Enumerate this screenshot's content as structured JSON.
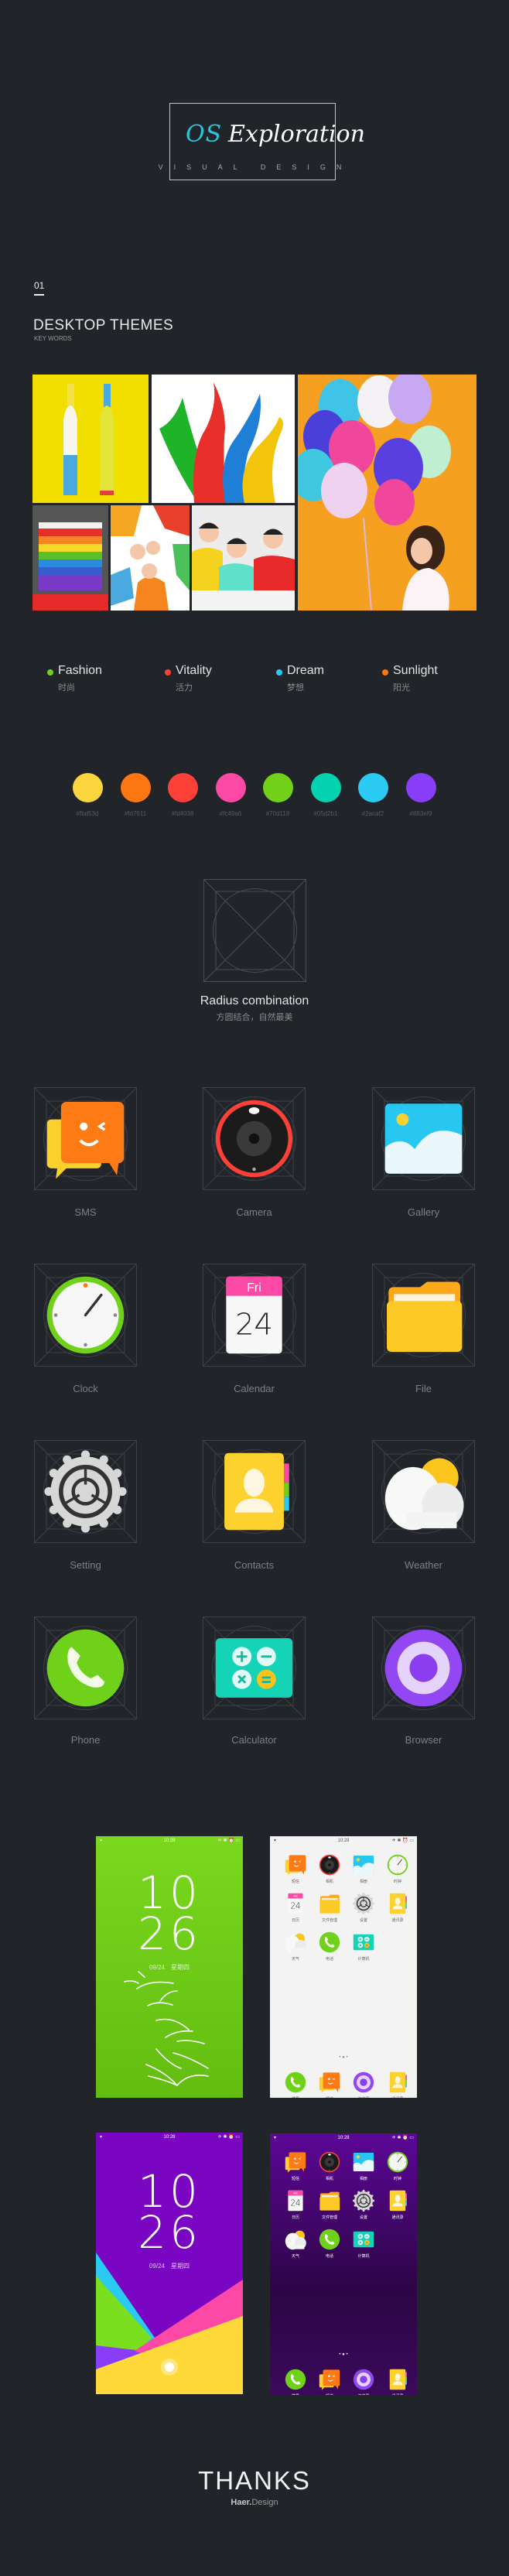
{
  "header": {
    "logo_os": "OS",
    "logo_rest": "Exploration",
    "tagline": "VISUAL DESIGN"
  },
  "section": {
    "number": "01",
    "title": "DESKTOP  THEMES",
    "subtitle": "KEY WORDS"
  },
  "keywords": [
    {
      "en": "Fashion",
      "cn": "时尚",
      "color": "#70d118"
    },
    {
      "en": "Vitality",
      "cn": "活力",
      "color": "#fd4038"
    },
    {
      "en": "Dream",
      "cn": "梦想",
      "color": "#2acaf2"
    },
    {
      "en": "Sunlight",
      "cn": "阳光",
      "color": "#fd7611"
    }
  ],
  "palette": [
    "#fbd53d",
    "#fd7611",
    "#fd4038",
    "#fc49a6",
    "#70d118",
    "#05d2b1",
    "#2acaf2",
    "#883ef9"
  ],
  "radius": {
    "title": "Radius combination",
    "subtitle": "方圆结合，自然最美"
  },
  "icons": [
    {
      "key": "sms",
      "label": "SMS"
    },
    {
      "key": "camera",
      "label": "Camera"
    },
    {
      "key": "gallery",
      "label": "Gallery"
    },
    {
      "key": "clock",
      "label": "Clock"
    },
    {
      "key": "calendar",
      "label": "Calendar"
    },
    {
      "key": "file",
      "label": "File"
    },
    {
      "key": "setting",
      "label": "Setting"
    },
    {
      "key": "contacts",
      "label": "Contacts"
    },
    {
      "key": "weather",
      "label": "Weather"
    },
    {
      "key": "phone",
      "label": "Phone"
    },
    {
      "key": "calculator",
      "label": "Calculator"
    },
    {
      "key": "browser",
      "label": "Browser"
    }
  ],
  "calendar_icon": {
    "day": "Fri",
    "date": "24"
  },
  "screens": {
    "status_time": "10:28",
    "lock": {
      "hour": "10",
      "minute": "26",
      "date": "09/24",
      "weekday": "星期四"
    },
    "home_apps": [
      {
        "key": "sms",
        "label": "短信"
      },
      {
        "key": "camera",
        "label": "相机"
      },
      {
        "key": "gallery",
        "label": "相册"
      },
      {
        "key": "clock",
        "label": "时钟"
      },
      {
        "key": "calendar",
        "label": "日历"
      },
      {
        "key": "file",
        "label": "文件管理"
      },
      {
        "key": "setting",
        "label": "设置"
      },
      {
        "key": "contacts",
        "label": "通讯录"
      },
      {
        "key": "weather",
        "label": "天气"
      },
      {
        "key": "phone",
        "label": "电话"
      },
      {
        "key": "calculator",
        "label": "计算机"
      }
    ],
    "dock_apps": [
      {
        "key": "phone",
        "label": "拨号"
      },
      {
        "key": "sms",
        "label": "短信"
      },
      {
        "key": "browser",
        "label": "浏览器"
      },
      {
        "key": "contacts",
        "label": "通讯录"
      }
    ]
  },
  "footer": {
    "thanks": "THANKS",
    "brand_bold": "Haer.",
    "brand_rest": "Design"
  }
}
